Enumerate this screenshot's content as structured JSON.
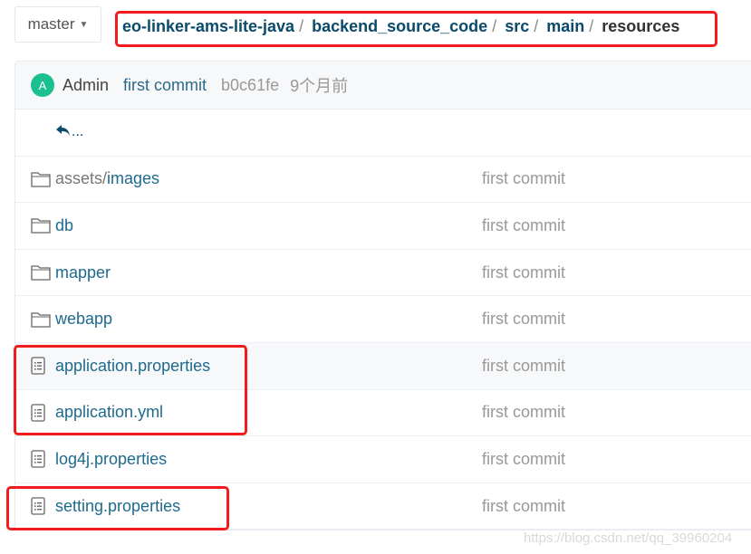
{
  "branch": {
    "label": "master",
    "icon": "caret-down-icon"
  },
  "breadcrumb": [
    {
      "label": "eo-linker-ams-lite-java"
    },
    {
      "label": "backend_source_code"
    },
    {
      "label": "src"
    },
    {
      "label": "main"
    },
    {
      "label": "resources"
    }
  ],
  "breadcrumb_sep": "/",
  "commit": {
    "avatar_letter": "A",
    "author": "Admin",
    "message": "first commit",
    "sha": "b0c61fe",
    "time": "9个月前"
  },
  "parent": {
    "label": "...",
    "icon": "reply-arrow-icon"
  },
  "files": [
    {
      "prefix": "assets/",
      "name": "images",
      "type": "folder",
      "message": "first commit"
    },
    {
      "name": "db",
      "type": "folder",
      "message": "first commit"
    },
    {
      "name": "mapper",
      "type": "folder",
      "message": "first commit"
    },
    {
      "name": "webapp",
      "type": "folder",
      "message": "first commit"
    },
    {
      "name": "application.properties",
      "type": "file",
      "message": "first commit"
    },
    {
      "name": "application.yml",
      "type": "file",
      "message": "first commit"
    },
    {
      "name": "log4j.properties",
      "type": "file",
      "message": "first commit"
    },
    {
      "name": "setting.properties",
      "type": "file",
      "message": "first commit"
    }
  ],
  "colors": {
    "highlight": "#f21c1c",
    "link": "#1e6a8d",
    "avatar": "#1cbf8f"
  },
  "watermark": "https://blog.csdn.net/qq_39960204"
}
